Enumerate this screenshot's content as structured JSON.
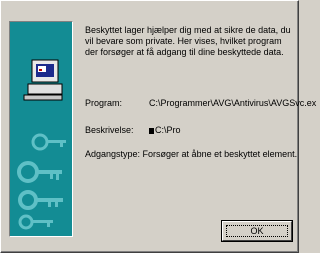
{
  "message": {
    "intro": "Beskyttet lager hjælper dig med at sikre de data, du vil bevare som private. Her vises, hvilket program der forsøger at få adgang til dine beskyttede data."
  },
  "details": {
    "program_label": "Program:",
    "program_value": "C:\\Programmer\\AVG\\Antivirus\\AVGSvc.ex",
    "description_label": "Beskrivelse:",
    "description_value": "C:\\Pro",
    "access_label": "Adgangstype: ",
    "access_value": "Forsøger at åbne et beskyttet element."
  },
  "buttons": {
    "ok_label": "OK"
  },
  "illustration": {
    "icon": "computer-keys-icon",
    "background_color": "#138c94"
  }
}
